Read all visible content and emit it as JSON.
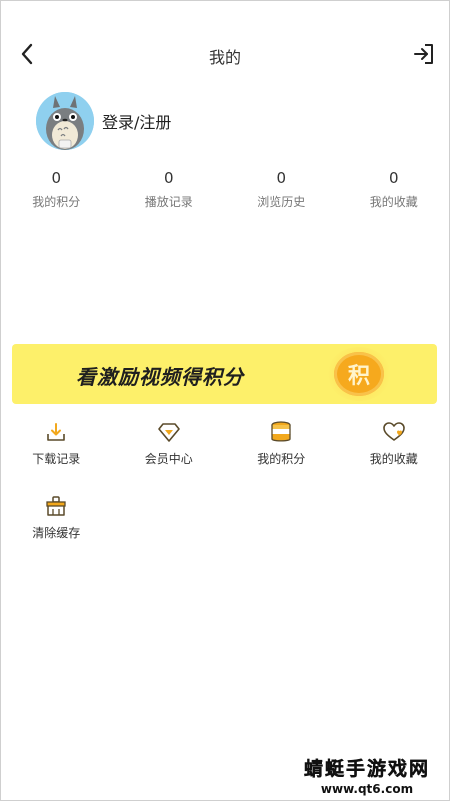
{
  "header": {
    "title": "我的",
    "back_icon": "chevron-left-icon",
    "logout_icon": "logout-arrow-icon"
  },
  "profile": {
    "login_label": "登录/注册",
    "avatar_icon": "totoro-avatar"
  },
  "stats": [
    {
      "value": "0",
      "label": "我的积分"
    },
    {
      "value": "0",
      "label": "播放记录"
    },
    {
      "value": "0",
      "label": "浏览历史"
    },
    {
      "value": "0",
      "label": "我的收藏"
    }
  ],
  "banner": {
    "text": "看激励视频得积分",
    "coin_text": "积",
    "background": "#fdf06a",
    "coin_color": "#f6a91d"
  },
  "menu": [
    {
      "label": "下载记录",
      "icon": "download-icon"
    },
    {
      "label": "会员中心",
      "icon": "diamond-icon"
    },
    {
      "label": "我的积分",
      "icon": "coin-stack-icon"
    },
    {
      "label": "我的收藏",
      "icon": "heart-icon"
    },
    {
      "label": "清除缓存",
      "icon": "broom-icon"
    }
  ],
  "watermark": {
    "title": "蜻蜓手游戏网",
    "url": "www.qt6.com"
  }
}
